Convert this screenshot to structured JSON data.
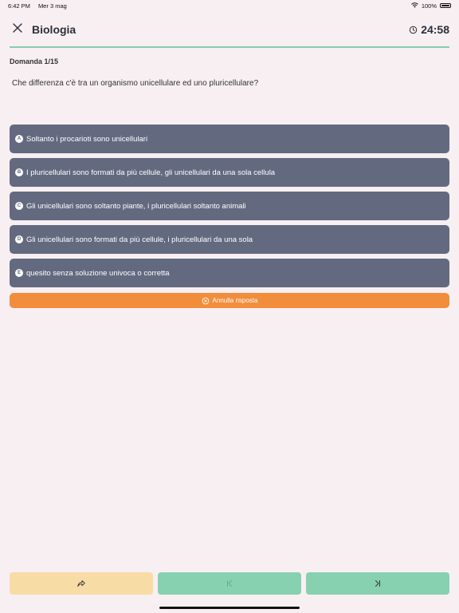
{
  "status_bar": {
    "time": "6:42 PM",
    "date": "Mer 3 mag",
    "battery": "100%"
  },
  "header": {
    "title": "Biologia",
    "timer": "24:58",
    "accent_color": "#86cdb0"
  },
  "question": {
    "counter": "Domanda 1/15",
    "text": "Che differenza c'è tra un organismo unicellulare ed uno pluricellulare?"
  },
  "answers": [
    {
      "letter": "A",
      "text": "Soltanto i procarioti sono unicellulari"
    },
    {
      "letter": "B",
      "text": "I pluricellulari sono formati da più cellule, gli unicellulari da una sola cellula"
    },
    {
      "letter": "C",
      "text": "Gli unicellulari sono soltanto piante, i pluricellulari soltanto animali"
    },
    {
      "letter": "D",
      "text": "Gli unicellulari sono formati da più cellule, i pluricellulari da una sola"
    },
    {
      "letter": "E",
      "text": "quesito senza soluzione univoca o corretta"
    }
  ],
  "cancel_answer_label": "Annulla risposta",
  "colors": {
    "answer_bg": "#636a80",
    "cancel_bg": "#f28d3c",
    "share_bg": "#f8dca5",
    "nav_bg": "#87d1b0",
    "page_bg": "#f8eff3"
  },
  "bottom_bar": {
    "icons": [
      "share-icon",
      "first-question-icon",
      "last-question-icon"
    ]
  }
}
